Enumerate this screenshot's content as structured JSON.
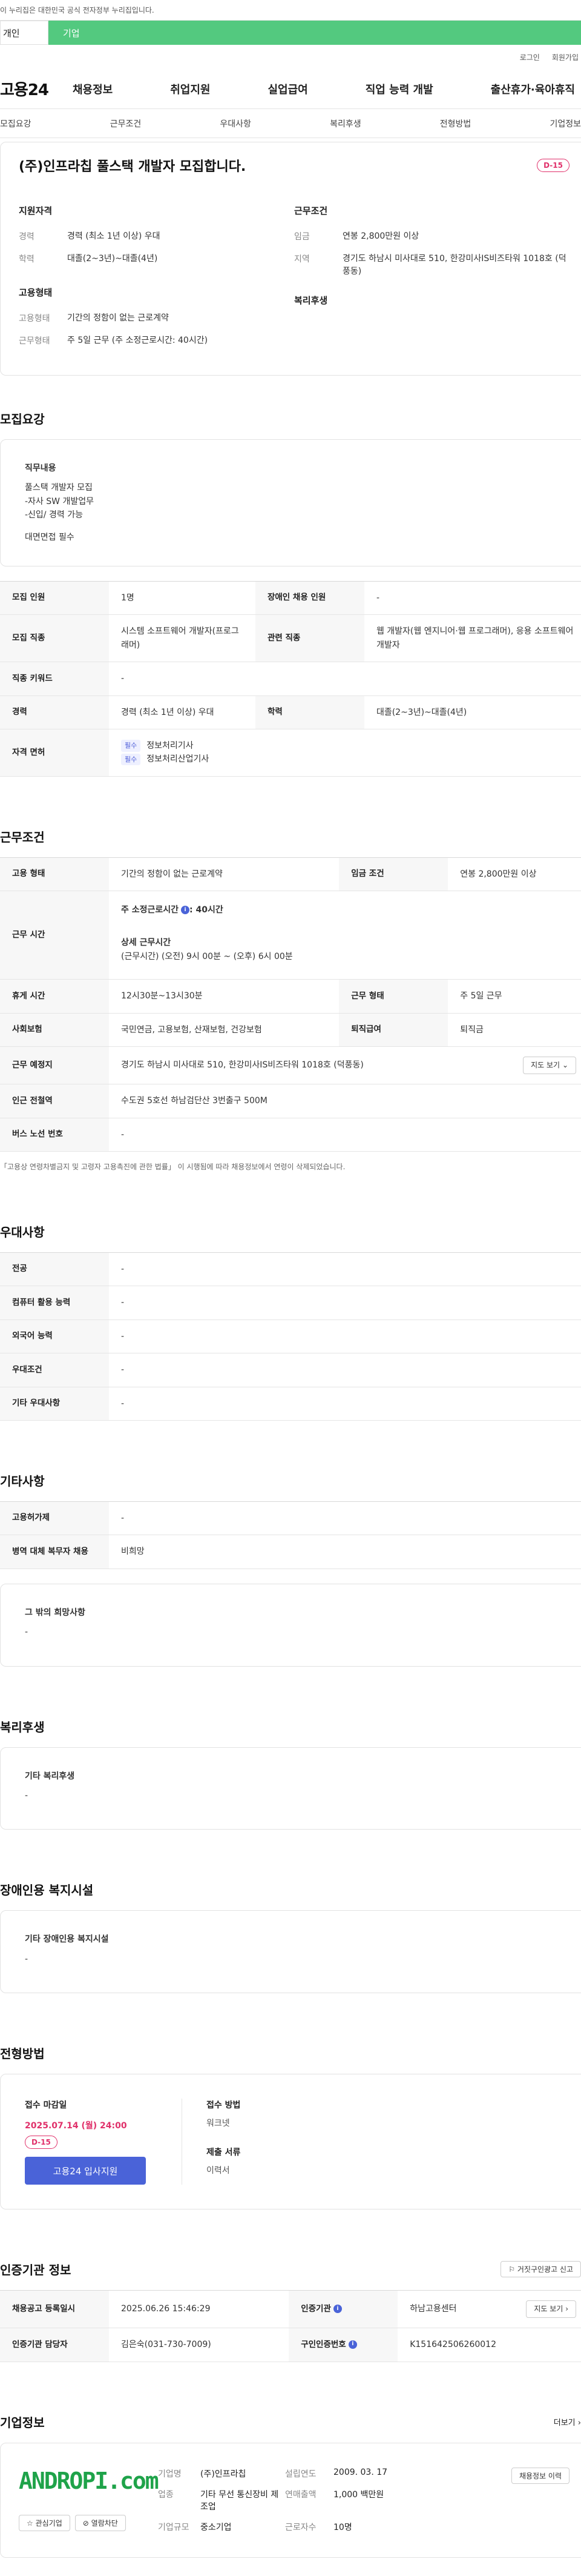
{
  "topbar": {
    "notice": "이 누리집은 대한민국 공식 전자정부 누리집입니다."
  },
  "tabs": {
    "personal": "개인",
    "corp": "기업"
  },
  "util": {
    "login": "로그인",
    "join": "회원가입"
  },
  "gnb": {
    "logo": "고용24",
    "items": [
      "채용정보",
      "취업지원",
      "실업급여",
      "직업 능력 개발",
      "출산휴가·육아휴직"
    ]
  },
  "subnav": [
    "모집요강",
    "근무조건",
    "우대사항",
    "복리후생",
    "전형방법",
    "기업정보"
  ],
  "header": {
    "title": "(주)인프라칩 풀스택 개발자 모집합니다.",
    "dday": "D-15",
    "qual_h": "지원자격",
    "career_k": "경력",
    "career_v": "경력 (최소 1년 이상) 우대",
    "edu_k": "학력",
    "edu_v": "대졸(2~3년)~대졸(4년)",
    "emp_h": "고용형태",
    "emptype_k": "고용형태",
    "emptype_v": "기간의 정함이 없는 근로계약",
    "worktype_k": "근무형태",
    "worktype_v": "주 5일 근무 (주 소정근로시간: 40시간)",
    "cond_h": "근무조건",
    "wage_k": "임금",
    "wage_v": "연봉 2,800만원 이상",
    "region_k": "지역",
    "region_v": "경기도 하남시 미사대로 510, 한강미사IS비즈타워 1018호 (덕풍동)",
    "welfare_h": "복리후생"
  },
  "recruit": {
    "title": "모집요강",
    "duty_h": "직무내용",
    "duty_lines": [
      "풀스택 개발자 모집",
      "-자사 SW 개발업무",
      "-신입/ 경력 가능"
    ],
    "duty_extra": "대면면접 필수",
    "rows": {
      "count_k": "모집 인원",
      "count_v": "1명",
      "disabled_k": "장애인 채용 인원",
      "disabled_v": "-",
      "job_k": "모집 직종",
      "job_v": "시스템 소프트웨어 개발자(프로그래머)",
      "rel_k": "관련 직종",
      "rel_v": "웹 개발자(웹 엔지니어·웹 프로그래머), 응용 소프트웨어 개발자",
      "kw_k": "직종 키워드",
      "kw_v": "-",
      "career_k": "경력",
      "career_v": "경력 (최소 1년 이상) 우대",
      "edu_k": "학력",
      "edu_v": "대졸(2~3년)~대졸(4년)",
      "lic_k": "자격 면허",
      "lic_tag": "필수",
      "lic1": "정보처리기사",
      "lic2": "정보처리산업기사"
    }
  },
  "work": {
    "title": "근무조건",
    "type_k": "고용 형태",
    "type_v": "기간의 정함이 없는 근로계약",
    "wage_k": "임금 조건",
    "wage_v": "연봉 2,800만원 이상",
    "time_k": "근무 시간",
    "time_h1": "주 소정근로시간",
    "time_h1_v": ": 40시간",
    "time_h2": "상세 근무시간",
    "time_v2": "(근무시간) (오전) 9시 00분 ~ (오후) 6시 00분",
    "rest_k": "휴게 시간",
    "rest_v": "12시30분~13시30분",
    "form_k": "근무 형태",
    "form_v": "주 5일 근무",
    "ins_k": "사회보험",
    "ins_v": "국민연금, 고용보험, 산재보험, 건강보험",
    "sev_k": "퇴직급여",
    "sev_v": "퇴직금",
    "loc_k": "근무 예정지",
    "loc_v": "경기도 하남시 미사대로 510, 한강미사IS비즈타워 1018호 (덕풍동)",
    "map_btn": "지도 보기",
    "sub_k": "인근 전철역",
    "sub_v": "수도권 5호선 하남검단산 3번출구 500M",
    "bus_k": "버스 노선 번호",
    "bus_v": "-",
    "note": "「고용상 연령차별금지 및 고령자 고용촉진에 관한 법률」 이 시행됨에 따라 채용정보에서 연령이 삭제되었습니다."
  },
  "pref": {
    "title": "우대사항",
    "rows": [
      [
        "전공",
        "-"
      ],
      [
        "컴퓨터 활용 능력",
        "-"
      ],
      [
        "외국어 능력",
        "-"
      ],
      [
        "우대조건",
        "-"
      ],
      [
        "기타 우대사항",
        "-"
      ]
    ]
  },
  "etc": {
    "title": "기타사항",
    "rows": [
      [
        "고용허가제",
        "-"
      ],
      [
        "병역 대체 복무자 채용",
        "비희망"
      ]
    ],
    "box_h": "그 밖의 희망사항",
    "box_v": "-"
  },
  "welfare": {
    "title": "복리후생",
    "box_h": "기타 복리후생",
    "box_v": "-"
  },
  "disab": {
    "title": "장애인용 복지시설",
    "box_h": "기타 장애인용 복지시설",
    "box_v": "-"
  },
  "apply": {
    "title": "전형방법",
    "deadline_h": "접수 마감일",
    "deadline_v": "2025.07.14 (월) 24:00",
    "dday": "D-15",
    "btn": "고용24 입사지원",
    "method_h": "접수 방법",
    "method_v": "워크넷",
    "docs_h": "제출 서류",
    "docs_v": "이력서"
  },
  "cert": {
    "title": "인증기관 정보",
    "report_btn": "거짓구인광고 신고",
    "reg_k": "채용공고 등록일시",
    "reg_v": "2025.06.26 15:46:29",
    "org_k": "인증기관",
    "org_v": "하남고용센터",
    "map_btn": "지도 보기",
    "mgr_k": "인증기관 담당자",
    "mgr_v": "김은숙(031-730-7009)",
    "no_k": "구인인증번호",
    "no_v": "K151642506260012"
  },
  "company": {
    "title": "기업정보",
    "more": "더보기",
    "logo_text": "ANDROPI.com",
    "fav_btn": "관심기업",
    "block_btn": "열람차단",
    "name_k": "기업명",
    "name_v": "(주)인프라칩",
    "year_k": "설립연도",
    "year_v": "2009. 03. 17",
    "ind_k": "업종",
    "ind_v": "기타 무선 통신장비 제조업",
    "sales_k": "연매출액",
    "sales_v": "1,000 백만원",
    "size_k": "기업규모",
    "size_v": "중소기업",
    "emp_k": "근로자수",
    "emp_v": "10명",
    "hist_btn": "채용정보 이력"
  }
}
